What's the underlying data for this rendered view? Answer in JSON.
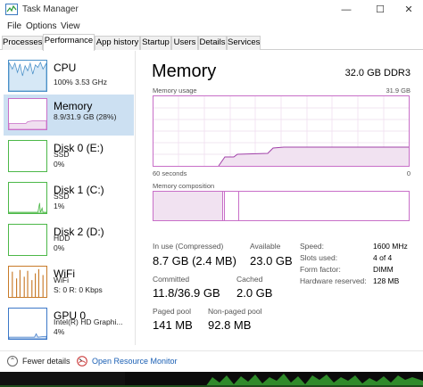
{
  "window": {
    "title": "Task Manager"
  },
  "menu": [
    "File",
    "Options",
    "View"
  ],
  "tabs": [
    "Processes",
    "Performance",
    "App history",
    "Startup",
    "Users",
    "Details",
    "Services"
  ],
  "sidebar": [
    {
      "name": "CPU",
      "line1": "100%  3.53 GHz",
      "line2": ""
    },
    {
      "name": "Memory",
      "line1": "8.9/31.9 GB (28%)",
      "line2": ""
    },
    {
      "name": "Disk 0 (E:)",
      "line1": "SSD",
      "line2": "0%"
    },
    {
      "name": "Disk 1 (C:)",
      "line1": "SSD",
      "line2": "1%"
    },
    {
      "name": "Disk 2 (D:)",
      "line1": "HDD",
      "line2": "0%"
    },
    {
      "name": "WiFi",
      "line1": "WiFi",
      "line2": "S: 0  R: 0 Kbps"
    },
    {
      "name": "GPU 0",
      "line1": "Intel(R) HD Graphi...",
      "line2": "4%"
    }
  ],
  "main": {
    "title": "Memory",
    "spec": "32.0 GB DDR3",
    "usage_label": "Memory usage",
    "usage_max": "31.9 GB",
    "time_label": "60 seconds",
    "time_zero": "0",
    "composition_label": "Memory composition",
    "stats": {
      "in_use_label": "In use (Compressed)",
      "in_use_value": "8.7 GB (2.4 MB)",
      "available_label": "Available",
      "available_value": "23.0 GB",
      "committed_label": "Committed",
      "committed_value": "11.8/36.9 GB",
      "cached_label": "Cached",
      "cached_value": "2.0 GB",
      "paged_label": "Paged pool",
      "paged_value": "141 MB",
      "nonpaged_label": "Non-paged pool",
      "nonpaged_value": "92.8 MB"
    },
    "specs": [
      {
        "label": "Speed:",
        "value": "1600 MHz"
      },
      {
        "label": "Slots used:",
        "value": "4 of 4"
      },
      {
        "label": "Form factor:",
        "value": "DIMM"
      },
      {
        "label": "Hardware reserved:",
        "value": "128 MB"
      }
    ]
  },
  "footer": {
    "fewer_details": "Fewer details",
    "open_rm": "Open Resource Monitor"
  },
  "colors": {
    "memory": "#c86fc8",
    "cpu": "#4a90c8",
    "disk": "#4cb848",
    "wifi": "#c87a28",
    "gpu": "#3c78c8",
    "selected": "#cce0f2"
  }
}
